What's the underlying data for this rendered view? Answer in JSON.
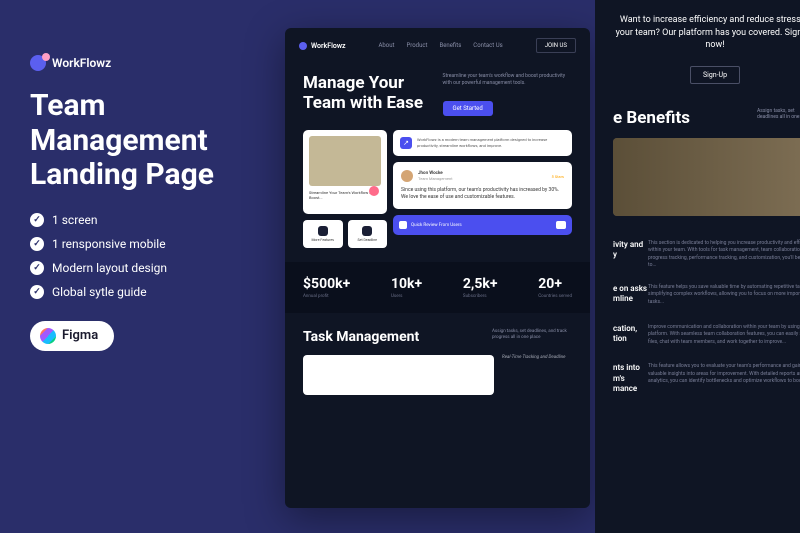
{
  "brand": "WorkFlowz",
  "title": "Team Management Landing Page",
  "features": [
    "1 screen",
    "1 rensponsive mobile",
    "Modern layout design",
    "Global sytle guide"
  ],
  "figma": "Figma",
  "mock1": {
    "nav": [
      "About",
      "Product",
      "Benefits",
      "Contact Us"
    ],
    "join": "JOIN US",
    "hero_title": "Manage Your Team with Ease",
    "hero_sub": "Streamline your team's workflow and boost productivity with our powerful management tools.",
    "cta": "Get Started",
    "img_card_text": "Streamline Your Team's Workflow and Boost...",
    "small_card1": "More Features",
    "small_card2": "Set Deadline",
    "wf_text": "WorkFlowz is a modern team management platform designed to increase productivity, streamline workflows, and improve.",
    "testimonial": {
      "name": "Jhon Wocke",
      "role": "Team Management",
      "stars": "5 Stars",
      "text": "Since using this platform, our team's productivity has increased by 30%. We love the ease of use and customizable features."
    },
    "review_card": "Quick Review From Users",
    "stats": [
      {
        "value": "$500k+",
        "label": "Annual profit"
      },
      {
        "value": "10k+",
        "label": "Users"
      },
      {
        "value": "2,5k+",
        "label": "Subscribers"
      },
      {
        "value": "20+",
        "label": "Countries served"
      }
    ],
    "task_title": "Task Management",
    "task_sub": "Assign tasks, set deadlines, and track progress all in one place",
    "task_side": "Real-Time Tracking and Deadline"
  },
  "mock2": {
    "cta_text": "Want to increase efficiency and reduce stress in your team? Our platform has you covered. Sign up now!",
    "signup": "Sign-Up",
    "benefits_title": "e Benefits",
    "benefits_sub": "Assign tasks, set deadlines all in one place",
    "blocks": [
      {
        "title": "ivity and y",
        "text": "This section is dedicated to helping you increase productivity and efficiency within your team. With tools for task management, team collaboration, progress tracking, performance tracking, and customization, you'll be able to..."
      },
      {
        "title": "e on asks mline",
        "text": "This feature helps you save valuable time by automating repetitive tasks and simplifying complex workflows, allowing you to focus on more important tasks..."
      },
      {
        "title": "cation, tion",
        "text": "Improve communication and collaboration within your team by using our platform. With seamless team collaboration features, you can easily share files, chat with team members, and work together to improve..."
      },
      {
        "title": "nts into m's mance",
        "text": "This feature allows you to evaluate your team's performance and gain valuable insights into areas for improvement. With detailed reports and analytics, you can identify bottlenecks and optimize workflows to boost..."
      }
    ]
  }
}
